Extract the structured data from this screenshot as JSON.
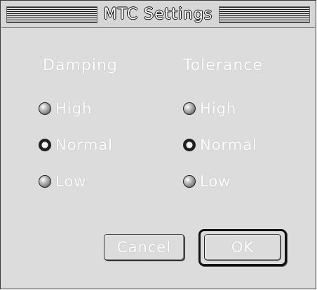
{
  "window": {
    "title": "MTC Settings"
  },
  "damping": {
    "header": "Damping",
    "options": [
      {
        "label": "High",
        "selected": false
      },
      {
        "label": "Normal",
        "selected": true
      },
      {
        "label": "Low",
        "selected": false
      }
    ]
  },
  "tolerance": {
    "header": "Tolerance",
    "options": [
      {
        "label": "High",
        "selected": false
      },
      {
        "label": "Normal",
        "selected": true
      },
      {
        "label": "Low",
        "selected": false
      }
    ]
  },
  "buttons": {
    "cancel_label": "Cancel",
    "ok_label": "OK"
  }
}
